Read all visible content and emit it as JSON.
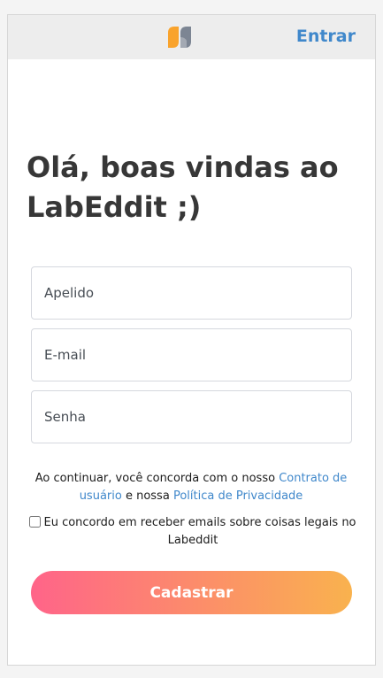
{
  "header": {
    "logo_icon": "labeddit-logo-icon",
    "login_label": "Entrar",
    "colors": {
      "logo_orange": "#f9a32c",
      "logo_gray": "#7c8593",
      "link": "#4088cb"
    }
  },
  "main": {
    "title": "Olá, boas vindas ao LabEddit ;)",
    "fields": {
      "nickname_placeholder": "Apelido",
      "email_placeholder": "E-mail",
      "password_placeholder": "Senha"
    },
    "terms": {
      "prefix": "Ao continuar, você concorda com o nosso ",
      "contract_link": "Contrato de usuário",
      "middle": " e nossa ",
      "privacy_link": "Política de Privacidade"
    },
    "optin": {
      "label": "Eu concordo em receber emails sobre coisas legais no Labeddit",
      "checked": false
    },
    "submit_label": "Cadastrar",
    "colors": {
      "gradient_start": "#ff6489",
      "gradient_end": "#f9b24e"
    }
  }
}
